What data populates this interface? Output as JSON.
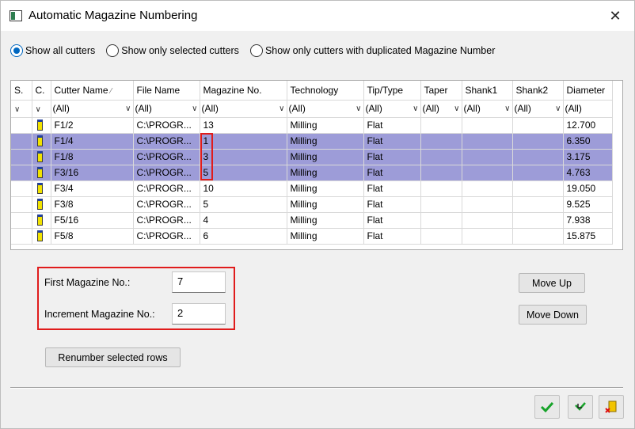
{
  "window": {
    "title": "Automatic Magazine Numbering",
    "close_glyph": "✕"
  },
  "filter_mode": {
    "options": [
      {
        "label": "Show all cutters",
        "checked": true
      },
      {
        "label": "Show only selected cutters",
        "checked": false
      },
      {
        "label": "Show only cutters with duplicated Magazine Number",
        "checked": false
      }
    ]
  },
  "grid": {
    "columns": [
      "S.",
      "C.",
      "Cutter Name",
      "File Name",
      "Magazine No.",
      "Technology",
      "Tip/Type",
      "Taper",
      "Shank1",
      "Shank2",
      "Diameter"
    ],
    "filter_value": "(All)",
    "rows": [
      {
        "name": "F1/2",
        "file": "C:\\PROGR...",
        "mag": "13",
        "tech": "Milling",
        "tip": "Flat",
        "diameter": "12.700",
        "selected": false
      },
      {
        "name": "F1/4",
        "file": "C:\\PROGR...",
        "mag": "1",
        "tech": "Milling",
        "tip": "Flat",
        "diameter": "6.350",
        "selected": true
      },
      {
        "name": "F1/8",
        "file": "C:\\PROGR...",
        "mag": "3",
        "tech": "Milling",
        "tip": "Flat",
        "diameter": "3.175",
        "selected": true
      },
      {
        "name": "F3/16",
        "file": "C:\\PROGR...",
        "mag": "5",
        "tech": "Milling",
        "tip": "Flat",
        "diameter": "4.763",
        "selected": true
      },
      {
        "name": "F3/4",
        "file": "C:\\PROGR...",
        "mag": "10",
        "tech": "Milling",
        "tip": "Flat",
        "diameter": "19.050",
        "selected": false
      },
      {
        "name": "F3/8",
        "file": "C:\\PROGR...",
        "mag": "5",
        "tech": "Milling",
        "tip": "Flat",
        "diameter": "9.525",
        "selected": false
      },
      {
        "name": "F5/16",
        "file": "C:\\PROGR...",
        "mag": "4",
        "tech": "Milling",
        "tip": "Flat",
        "diameter": "7.938",
        "selected": false
      },
      {
        "name": "F5/8",
        "file": "C:\\PROGR...",
        "mag": "6",
        "tech": "Milling",
        "tip": "Flat",
        "diameter": "15.875",
        "selected": false
      }
    ],
    "selection_color": "#9d9cd8"
  },
  "numbering": {
    "first_label": "First Magazine No.:",
    "first_value": "7",
    "increment_label": "Increment Magazine No.:",
    "increment_value": "2",
    "renumber_label": "Renumber selected rows",
    "highlight_color": "#e01c1c"
  },
  "order": {
    "move_up_label": "Move Up",
    "move_down_label": "Move Down"
  },
  "footer": {
    "icons": [
      "ok-check-icon",
      "apply-check-icon",
      "cancel-exit-icon"
    ]
  }
}
